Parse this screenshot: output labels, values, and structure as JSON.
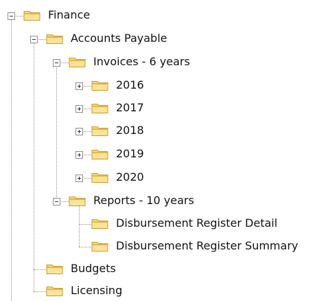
{
  "tree": {
    "finance": {
      "label": "Finance",
      "state": "expanded",
      "icon": "folder-icon"
    },
    "accounts_payable": {
      "label": "Accounts Payable",
      "state": "expanded",
      "icon": "folder-icon"
    },
    "invoices": {
      "label": "Invoices - 6 years",
      "state": "expanded",
      "icon": "folder-icon",
      "children": [
        {
          "label": "2016",
          "state": "collapsed"
        },
        {
          "label": "2017",
          "state": "collapsed"
        },
        {
          "label": "2018",
          "state": "collapsed"
        },
        {
          "label": "2019",
          "state": "collapsed"
        },
        {
          "label": "2020",
          "state": "collapsed"
        }
      ]
    },
    "reports": {
      "label": "Reports - 10 years",
      "state": "expanded",
      "icon": "folder-icon",
      "children": [
        {
          "label": "Disbursement Register Detail"
        },
        {
          "label": "Disbursement Register Summary"
        }
      ]
    },
    "budgets": {
      "label": "Budgets",
      "icon": "folder-icon"
    },
    "licensing": {
      "label": "Licensing",
      "icon": "folder-icon"
    }
  },
  "colors": {
    "folder_fill": "#f9d876",
    "folder_shade": "#e7b73d",
    "folder_outline": "#c99a29",
    "connector": "#8c8c8c",
    "text": "#111111"
  }
}
